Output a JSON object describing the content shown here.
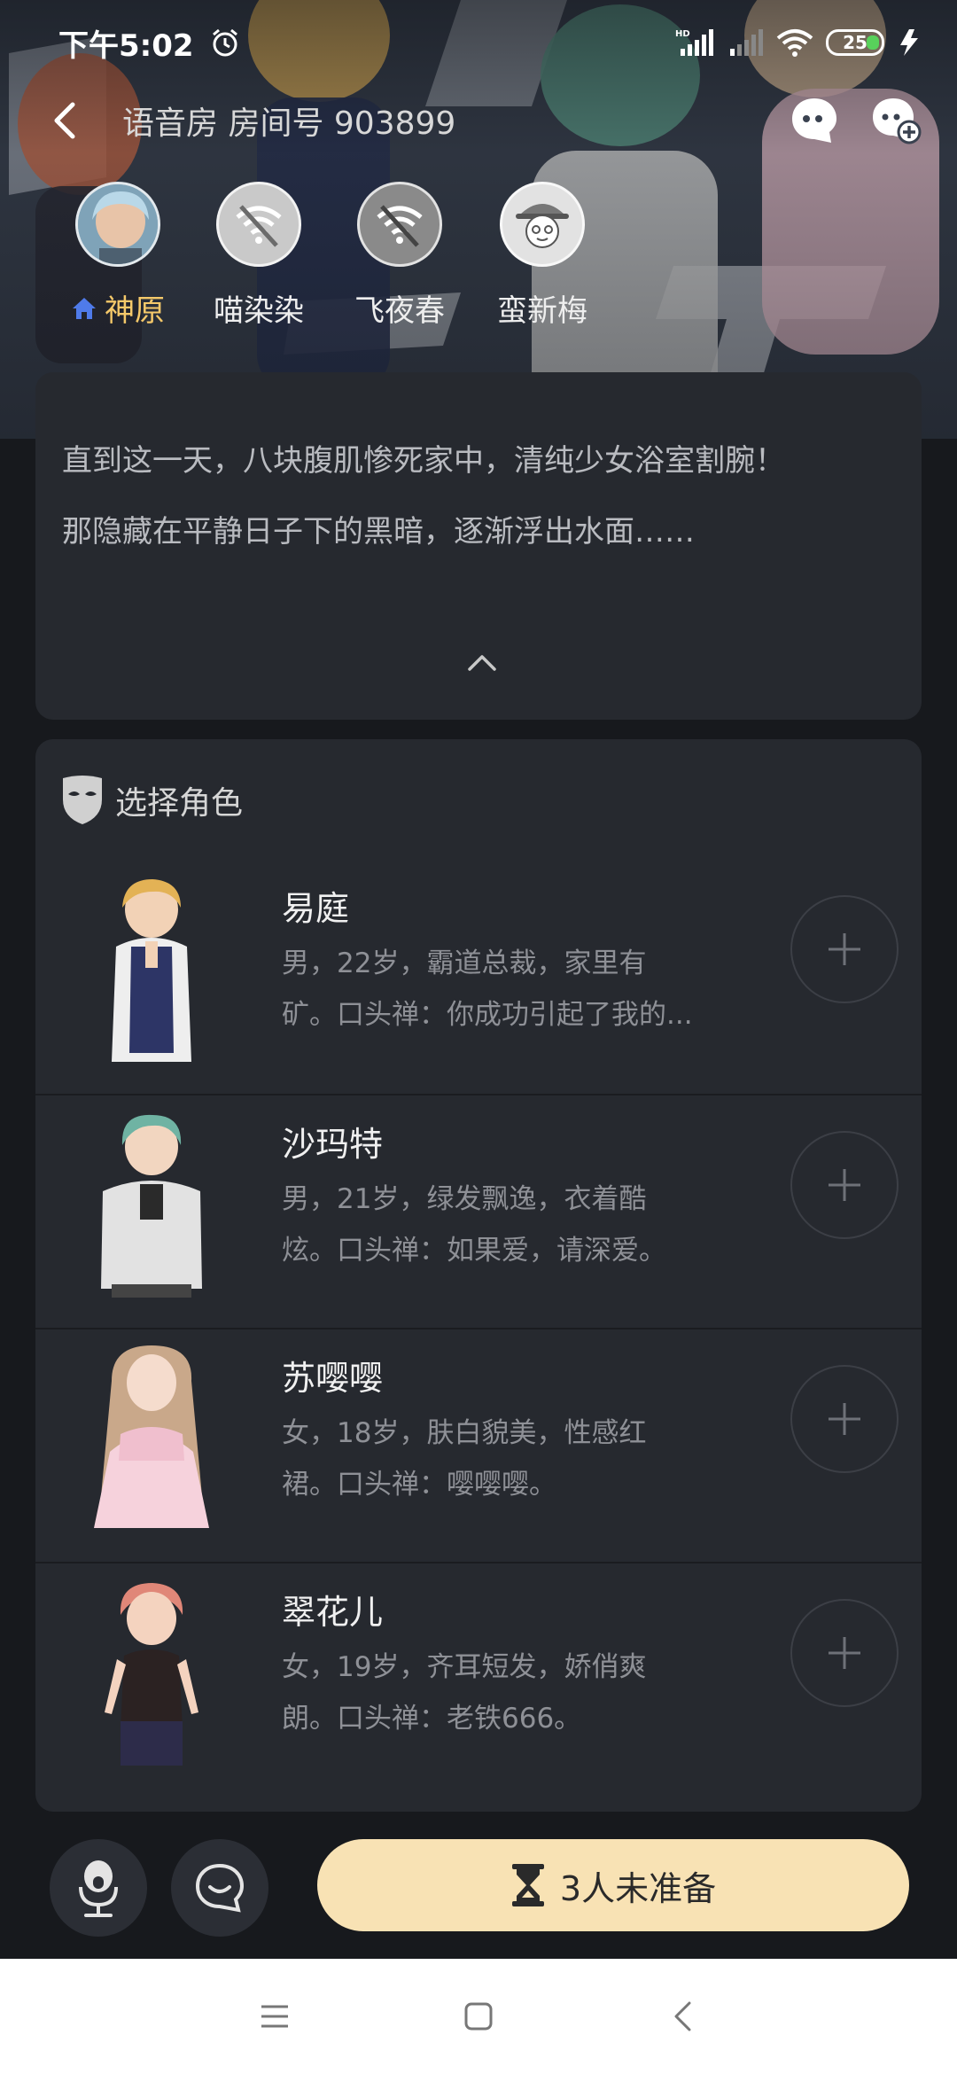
{
  "status_bar": {
    "time": "下午5:02",
    "battery": "25",
    "signal_label": "HD"
  },
  "nav": {
    "room_title": "语音房 房间号 903899"
  },
  "players": [
    {
      "name": "神原",
      "is_host": true
    },
    {
      "name": "喵染染",
      "is_host": false
    },
    {
      "name": "飞夜春",
      "is_host": false
    },
    {
      "name": "蛮新梅",
      "is_host": false
    }
  ],
  "intro": {
    "line1": "直到这一天，八块腹肌惨死家中，清纯少女浴室割腕！",
    "line2": "那隐藏在平静日子下的黑暗，逐渐浮出水面……"
  },
  "roles": {
    "title": "选择角色",
    "items": [
      {
        "name": "易庭",
        "desc_line1": "男，22岁，霸道总裁，家里有",
        "desc_line2": "矿。口头禅：你成功引起了我的..."
      },
      {
        "name": "沙玛特",
        "desc_line1": "男，21岁，绿发飘逸，衣着酷",
        "desc_line2": "炫。口头禅：如果爱，请深爱。"
      },
      {
        "name": "苏嘤嘤",
        "desc_line1": "女，18岁，肤白貌美，性感红",
        "desc_line2": "裙。口头禅：嘤嘤嘤。"
      },
      {
        "name": "翠花儿",
        "desc_line1": "女，19岁，齐耳短发，娇俏爽",
        "desc_line2": "朗。口头禅：老铁666。"
      }
    ]
  },
  "bottom": {
    "ready_label": "3人未准备"
  },
  "colors": {
    "accent_gold": "#f5c96a",
    "ready_bg": "#f8e2b4",
    "card_bg": "#26292f",
    "page_bg": "#17191d"
  }
}
